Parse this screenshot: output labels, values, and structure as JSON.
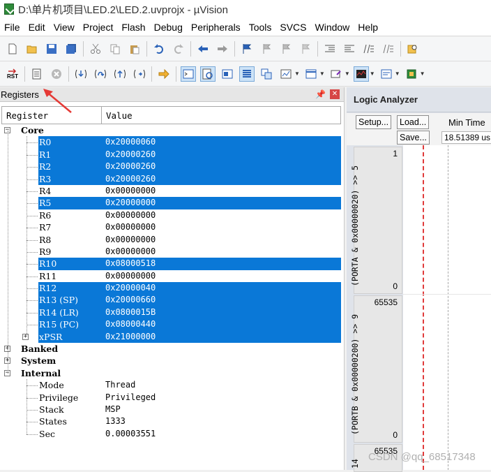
{
  "window": {
    "title": "D:\\单片机项目\\LED.2\\LED.2.uvprojx - µVision"
  },
  "menu": [
    "File",
    "Edit",
    "View",
    "Project",
    "Flash",
    "Debug",
    "Peripherals",
    "Tools",
    "SVCS",
    "Window",
    "Help"
  ],
  "toolbar1_icons": [
    "new-file-icon",
    "open-file-icon",
    "save-icon",
    "save-all-icon",
    "cut-icon",
    "copy-icon",
    "paste-icon",
    "undo-icon",
    "redo-icon",
    "nav-back-icon",
    "nav-forward-icon",
    "bookmark-icon",
    "bookmark-prev-icon",
    "bookmark-next-icon",
    "bookmark-clear-icon",
    "indent-icon",
    "unindent-icon",
    "comment-icon",
    "uncomment-icon",
    "find-in-files-icon"
  ],
  "toolbar2": {
    "reset_label": "RST",
    "icons": [
      "reset-icon",
      "run-icon",
      "stop-icon",
      "step-into-icon",
      "step-over-icon",
      "step-out-icon",
      "run-to-cursor-icon",
      "show-next-statement-icon",
      "command-window-icon",
      "disassembly-window-icon",
      "symbols-window-icon",
      "registers-window-icon",
      "call-stack-icon",
      "watch-window-icon",
      "memory-window-icon",
      "serial-window-icon",
      "analysis-window-icon",
      "trace-window-icon",
      "system-viewer-icon"
    ]
  },
  "registers_pane": {
    "title": "Registers",
    "columns": {
      "register": "Register",
      "value": "Value"
    },
    "groups": {
      "core": {
        "label": "Core",
        "expanded": true
      },
      "banked": {
        "label": "Banked",
        "expanded": false
      },
      "system": {
        "label": "System",
        "expanded": false
      },
      "internal": {
        "label": "Internal",
        "expanded": true
      }
    },
    "core_registers": [
      {
        "name": "R0",
        "value": "0x20000060",
        "selected": true
      },
      {
        "name": "R1",
        "value": "0x20000260",
        "selected": true
      },
      {
        "name": "R2",
        "value": "0x20000260",
        "selected": true
      },
      {
        "name": "R3",
        "value": "0x20000260",
        "selected": true
      },
      {
        "name": "R4",
        "value": "0x00000000",
        "selected": false
      },
      {
        "name": "R5",
        "value": "0x20000000",
        "selected": true
      },
      {
        "name": "R6",
        "value": "0x00000000",
        "selected": false
      },
      {
        "name": "R7",
        "value": "0x00000000",
        "selected": false
      },
      {
        "name": "R8",
        "value": "0x00000000",
        "selected": false
      },
      {
        "name": "R9",
        "value": "0x00000000",
        "selected": false
      },
      {
        "name": "R10",
        "value": "0x08000518",
        "selected": true
      },
      {
        "name": "R11",
        "value": "0x00000000",
        "selected": false
      },
      {
        "name": "R12",
        "value": "0x20000040",
        "selected": true
      },
      {
        "name": "R13 (SP)",
        "value": "0x20000660",
        "selected": true
      },
      {
        "name": "R14 (LR)",
        "value": "0x0800015B",
        "selected": true
      },
      {
        "name": "R15 (PC)",
        "value": "0x08000440",
        "selected": true
      },
      {
        "name": "xPSR",
        "value": "0x21000000",
        "selected": true,
        "expandable": true
      }
    ],
    "internal": [
      {
        "name": "Mode",
        "value": "Thread"
      },
      {
        "name": "Privilege",
        "value": "Privileged"
      },
      {
        "name": "Stack",
        "value": "MSP"
      },
      {
        "name": "States",
        "value": "1333"
      },
      {
        "name": "Sec",
        "value": "0.00003551"
      }
    ]
  },
  "logic_analyzer": {
    "title": "Logic Analyzer",
    "setup_label": "Setup...",
    "load_label": "Load...",
    "save_label": "Save...",
    "min_time_label": "Min Time",
    "min_time_value": "18.51389 us",
    "signals": [
      {
        "label": "(PORTA & 0x00000020) >> 5",
        "max": "1",
        "min": "0"
      },
      {
        "label": "(PORTB & 0x00000200) >> 9",
        "max": "65535",
        "min": "0"
      },
      {
        "label": "14",
        "max": "65535",
        "min": ""
      }
    ]
  },
  "watermark": "CSDN @qq_68517348",
  "colors": {
    "selection": "#0a78d7",
    "cursor_line": "#e03a3a",
    "annotation_arrow": "#e53935"
  }
}
